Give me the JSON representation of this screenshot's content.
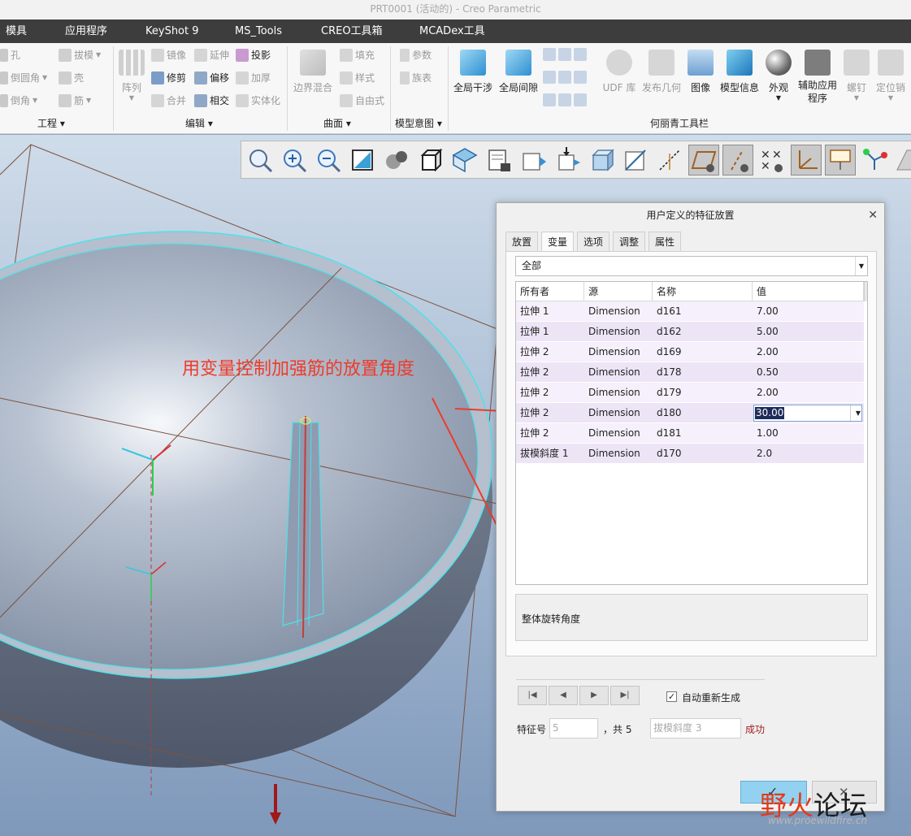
{
  "window": {
    "title": "PRT0001 (活动的) - Creo Parametric"
  },
  "menu": [
    "模具",
    "应用程序",
    "KeyShot 9",
    "MS_Tools",
    "CREO工具箱",
    "MCADex工具"
  ],
  "ribbon": {
    "engineering": {
      "items": [
        "孔",
        "倒圆角",
        "倒角",
        "拔模",
        "壳",
        "筋"
      ],
      "label": "工程"
    },
    "edit": {
      "array": "阵列",
      "items": [
        "镜像",
        "延伸",
        "投影",
        "修剪",
        "偏移",
        "加厚",
        "合并",
        "相交",
        "实体化"
      ],
      "label": "编辑"
    },
    "surface": {
      "items": [
        "边界混合",
        "填充",
        "样式",
        "自由式"
      ],
      "label": "曲面"
    },
    "model_intent": {
      "items": [
        "参数",
        "族表"
      ],
      "label": "模型意图"
    },
    "toolbar_group": {
      "items": [
        "全局干涉",
        "全局间隙",
        "UDF 库",
        "发布几何",
        "图像",
        "模型信息",
        "外观",
        "辅助应用程序",
        "螺钉",
        "定位销"
      ],
      "label": "何丽青工具栏"
    }
  },
  "annotation": {
    "text": "用变量控制加强筋的放置角度"
  },
  "dialog": {
    "title": "用户定义的特征放置",
    "tabs": [
      "放置",
      "变量",
      "选项",
      "调整",
      "属性"
    ],
    "active_tab": "变量",
    "filter": "全部",
    "columns": [
      "所有者",
      "源",
      "名称",
      "值"
    ],
    "rows": [
      {
        "owner": "拉伸 1",
        "source": "Dimension",
        "name": "d161",
        "value": "7.00"
      },
      {
        "owner": "拉伸 1",
        "source": "Dimension",
        "name": "d162",
        "value": "5.00"
      },
      {
        "owner": "拉伸 2",
        "source": "Dimension",
        "name": "d169",
        "value": "2.00"
      },
      {
        "owner": "拉伸 2",
        "source": "Dimension",
        "name": "d178",
        "value": "0.50"
      },
      {
        "owner": "拉伸 2",
        "source": "Dimension",
        "name": "d179",
        "value": "2.00"
      },
      {
        "owner": "拉伸 2",
        "source": "Dimension",
        "name": "d180",
        "value": "30.00"
      },
      {
        "owner": "拉伸 2",
        "source": "Dimension",
        "name": "d181",
        "value": "1.00"
      },
      {
        "owner": "拔模斜度 1",
        "source": "Dimension",
        "name": "d170",
        "value": "2.0"
      }
    ],
    "description": "整体旋转角度",
    "auto_regen": "自动重新生成",
    "feature_label": "特征号",
    "feature_no": "5",
    "total_text": "，共 5",
    "feature_name": "拔模斜度 3",
    "status": "成功"
  },
  "watermark": {
    "brand1": "野火",
    "brand2": "论坛",
    "url": "www.proewildfire.cn"
  }
}
